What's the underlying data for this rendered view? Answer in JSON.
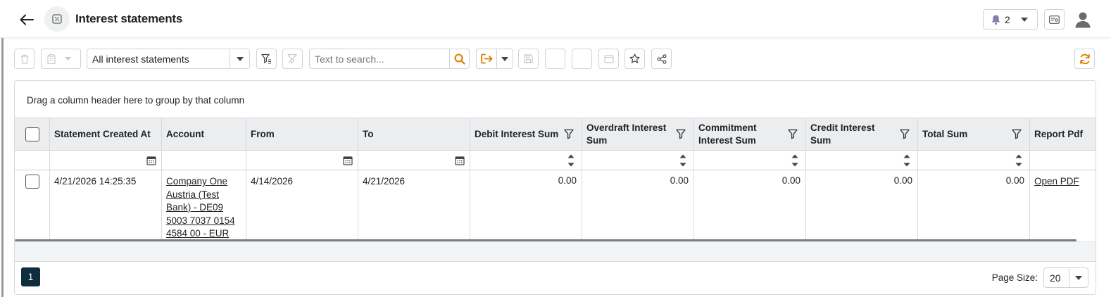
{
  "header": {
    "title": "Interest statements",
    "notification_count": "2"
  },
  "toolbar": {
    "view_select": "All interest statements",
    "search_placeholder": "Text to search...",
    "accent_color": "#e07b00"
  },
  "grid": {
    "group_hint": "Drag a column header here to group by that column",
    "columns": [
      "Statement Created At",
      "Account",
      "From",
      "To",
      "Debit Interest Sum",
      "Overdraft Interest Sum",
      "Commitment Interest Sum",
      "Credit Interest Sum",
      "Total Sum",
      "Report Pdf"
    ],
    "rows": [
      {
        "created_at": "4/21/2026 14:25:35",
        "account": "Company One Austria (Test Bank) - DE09 5003 7037 0154 4584 00 - EUR",
        "from": "4/14/2026",
        "to": "4/21/2026",
        "debit_interest_sum": "0.00",
        "overdraft_interest_sum": "0.00",
        "commitment_interest_sum": "0.00",
        "credit_interest_sum": "0.00",
        "total_sum": "0.00",
        "report_pdf": "Open PDF"
      }
    ]
  },
  "pager": {
    "current_page": "1",
    "page_size_label": "Page Size:",
    "page_size": "20"
  }
}
